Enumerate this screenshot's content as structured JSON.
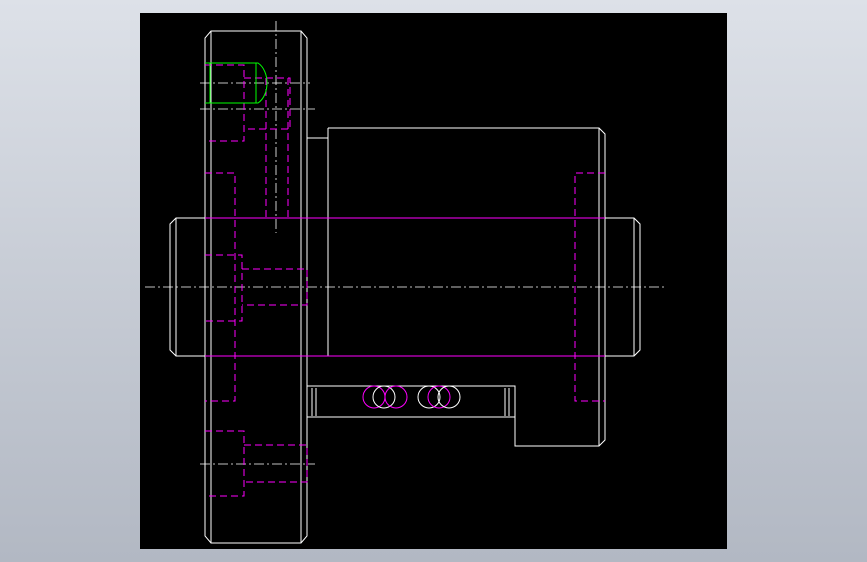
{
  "viewport": {
    "background": "#000000",
    "line_colors": {
      "visible_edge": "#ffffff",
      "hidden_edge": "#ff00ff",
      "highlight": "#00ff00",
      "centerline": "#ffffff"
    }
  }
}
